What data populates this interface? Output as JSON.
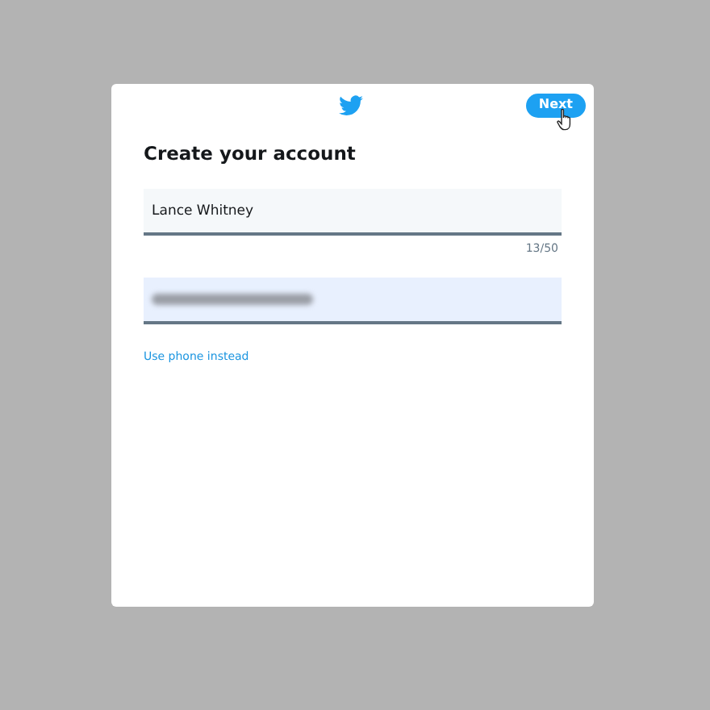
{
  "header": {
    "button": "Next"
  },
  "title": "Create your account",
  "name_field": {
    "value": "Lance Whitney",
    "counter": "13/50"
  },
  "email_field": {
    "blurred": true
  },
  "link": "Use phone instead"
}
